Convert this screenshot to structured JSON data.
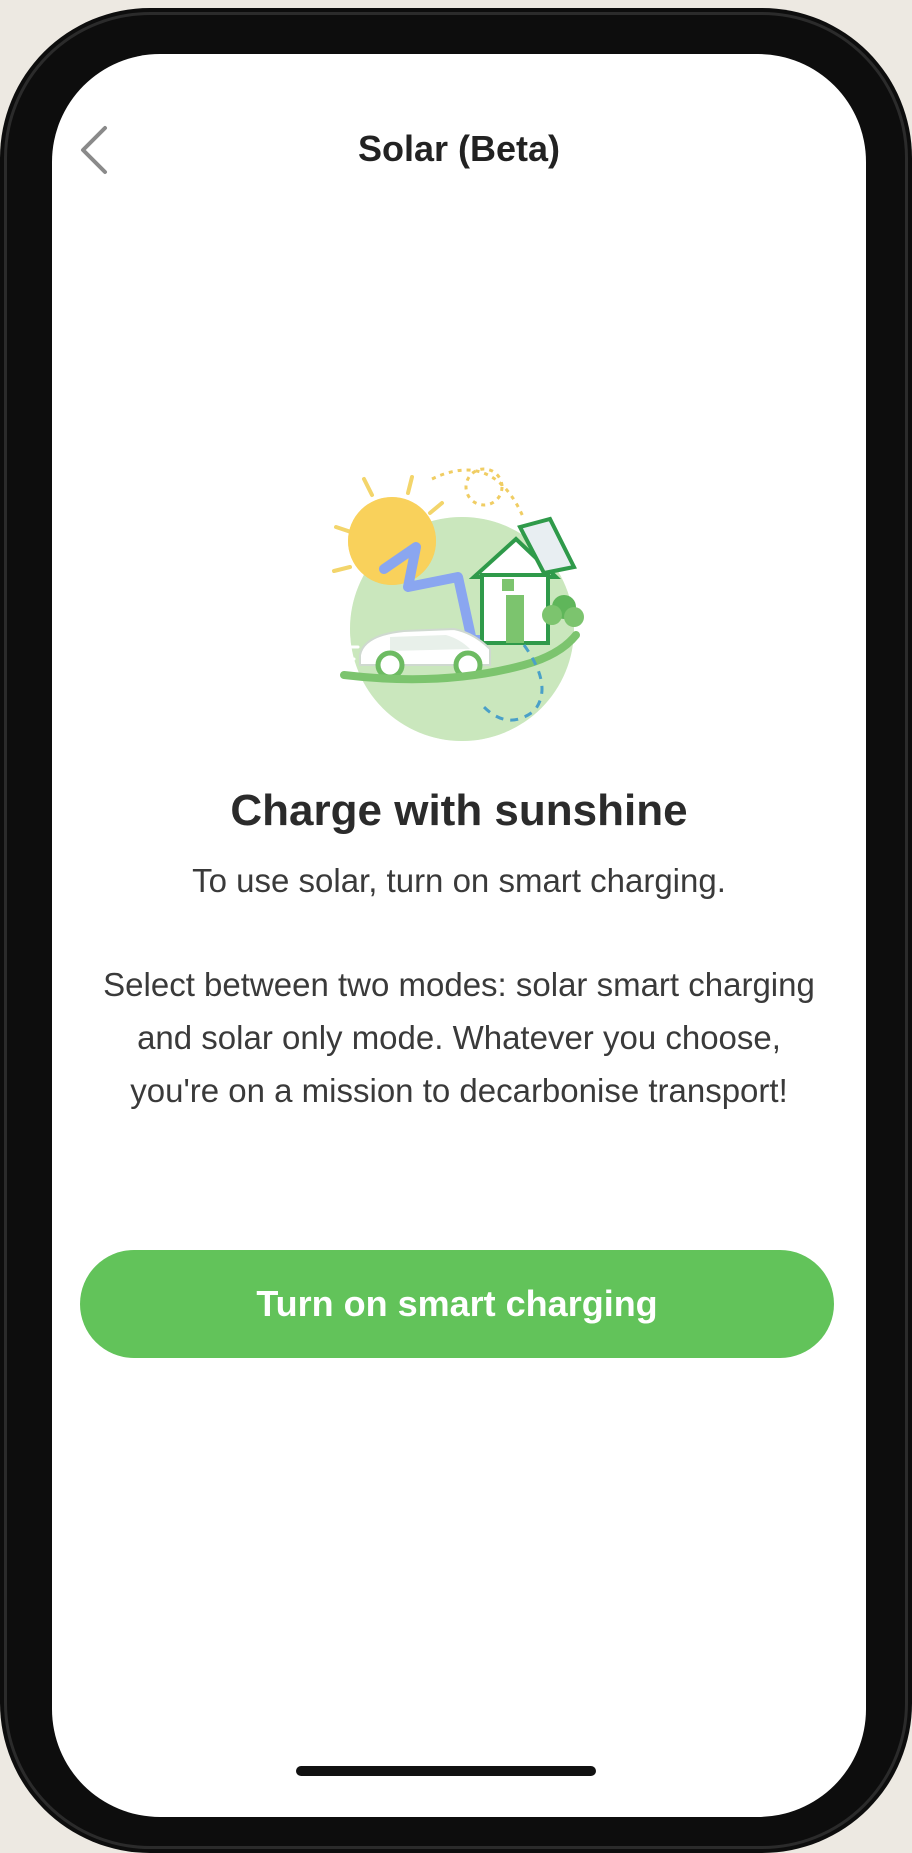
{
  "nav": {
    "title": "Solar (Beta)",
    "back_icon": "chevron-left-icon"
  },
  "hero": {
    "illustration": "solar-house-car-illustration",
    "headline": "Charge with sunshine",
    "subtitle": "To use solar, turn on smart charging.",
    "body": "Select between two modes: solar smart charging and solar only mode. Whatever you choose, you're on a mission to decarbonise transport!"
  },
  "actions": {
    "primary_label": "Turn on smart charging"
  },
  "colors": {
    "accent": "#62c35a",
    "text": "#2b2b2b",
    "sun": "#f7c84a",
    "arrow": "#8aa6f0",
    "frame": "#0d0d0d",
    "background": "#ede9e2"
  }
}
